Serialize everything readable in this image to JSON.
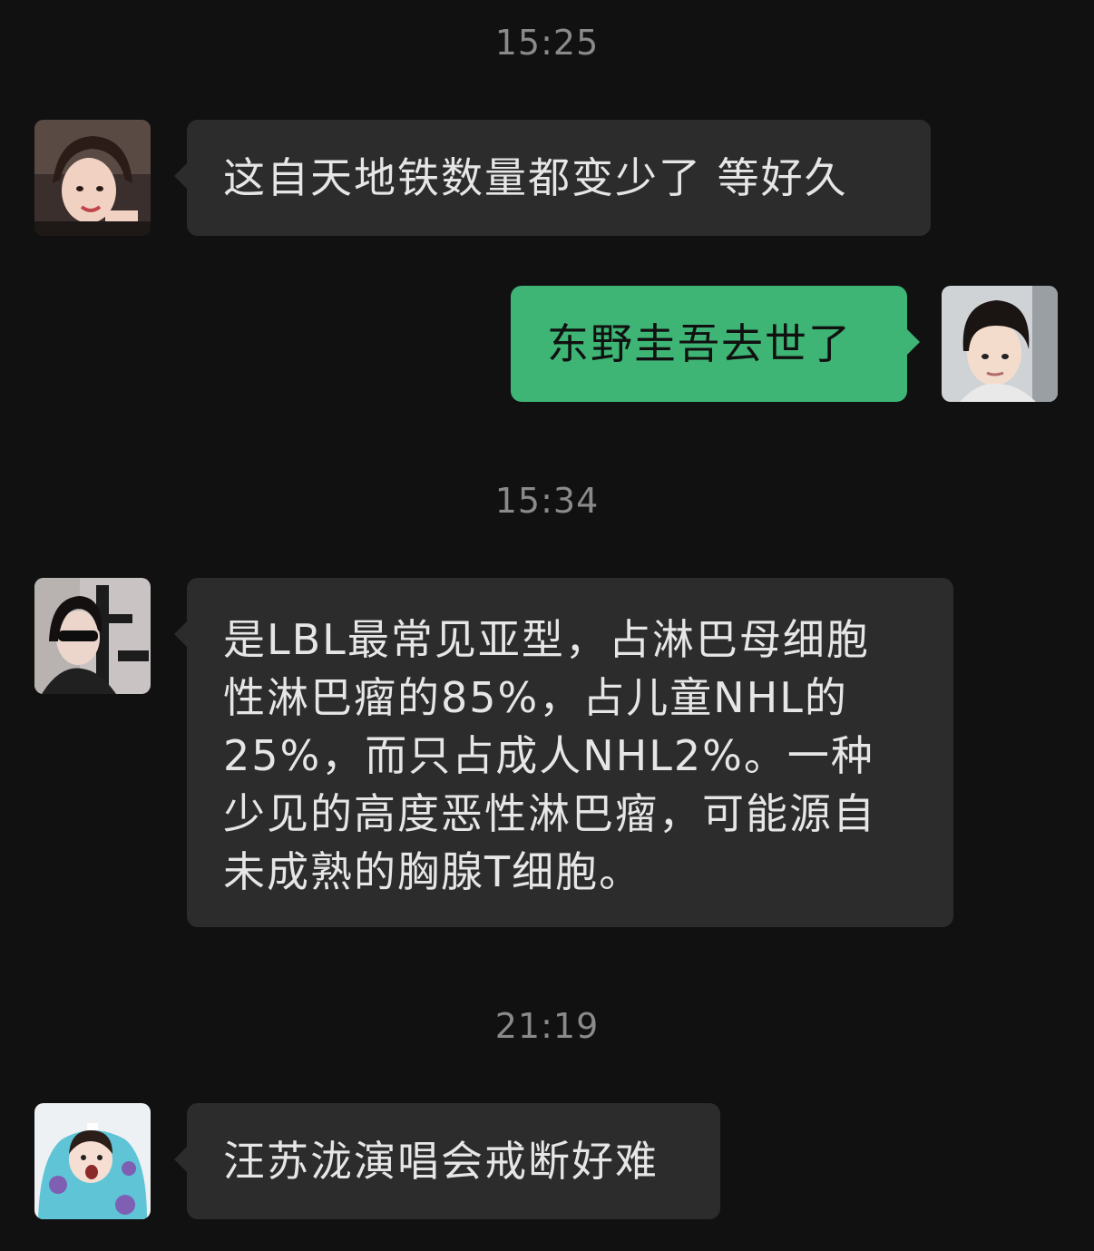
{
  "colors": {
    "background": "#111111",
    "timestamp": "#8a8a8a",
    "incoming_bubble": "#2c2c2c",
    "outgoing_bubble": "#3eb575",
    "incoming_text": "#e6e6e6",
    "outgoing_text": "#101010"
  },
  "messages": [
    {
      "type": "timestamp",
      "text": "15:25"
    },
    {
      "type": "incoming",
      "avatar": "avatar-girl-smiling",
      "text": "这自天地铁数量都变少了  等好久"
    },
    {
      "type": "outgoing",
      "avatar": "avatar-short-hair-boy",
      "text": "东野圭吾去世了"
    },
    {
      "type": "timestamp",
      "text": "15:34"
    },
    {
      "type": "incoming",
      "avatar": "avatar-girl-sunglasses",
      "lines": [
        "是LBL最常见亚型，占淋巴母细胞",
        "性淋巴瘤的85%，占儿童NHL的",
        "25%，而只占成人NHL2%。一种",
        "少见的高度恶性淋巴瘤，可能源自",
        "未成熟的胸腺T细胞。"
      ]
    },
    {
      "type": "timestamp",
      "text": "21:19"
    },
    {
      "type": "incoming",
      "avatar": "avatar-baby-blue-hoodie",
      "text": "汪苏泷演唱会戒断好难"
    }
  ]
}
